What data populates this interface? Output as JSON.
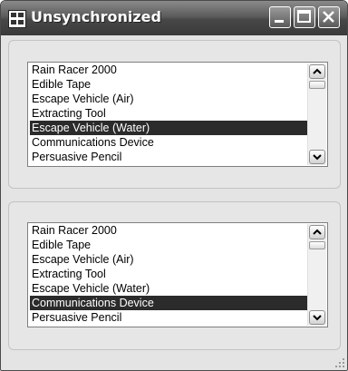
{
  "window": {
    "title": "Unsynchronized",
    "buttons": {
      "minimize": "minimize-icon",
      "maximize": "maximize-icon",
      "close": "close-icon"
    }
  },
  "list1": {
    "items": [
      "Rain Racer 2000",
      "Edible Tape",
      "Escape Vehicle (Air)",
      "Extracting Tool",
      "Escape Vehicle (Water)",
      "Communications Device",
      "Persuasive Pencil"
    ],
    "selected_index": 4
  },
  "list2": {
    "items": [
      "Rain Racer 2000",
      "Edible Tape",
      "Escape Vehicle (Air)",
      "Extracting Tool",
      "Escape Vehicle (Water)",
      "Communications Device",
      "Persuasive Pencil"
    ],
    "selected_index": 5
  },
  "colors": {
    "selection": "#2b2b2b",
    "titlebar": "#4a4a4a"
  }
}
